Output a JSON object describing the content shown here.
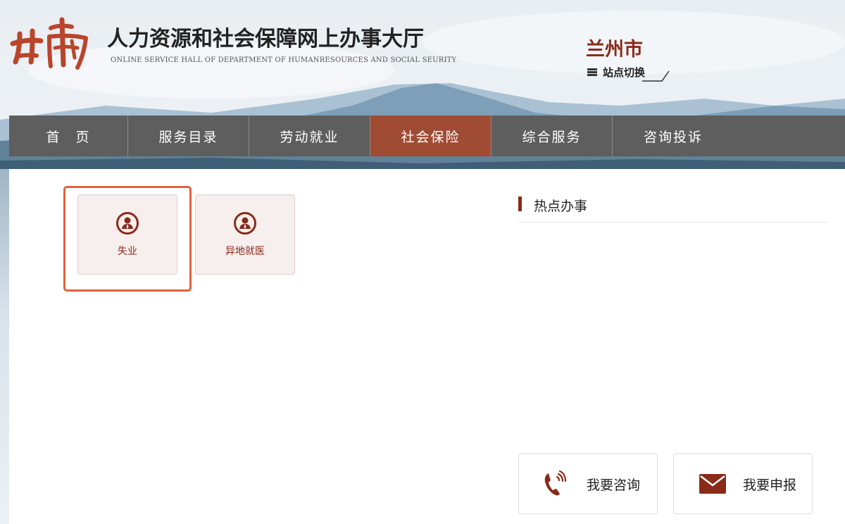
{
  "header": {
    "logo_text": "甘肃",
    "title": "人力资源和社会保障网上办事大厅",
    "subtitle": "ONLINE SERVICE HALL OF DEPARTMENT OF HUMANRESOURCES AND SOCIAL SEURITY",
    "city": "兰州市",
    "switch_label": "站点切换"
  },
  "nav": {
    "items": [
      {
        "label": "首　页",
        "active": false
      },
      {
        "label": "服务目录",
        "active": false
      },
      {
        "label": "劳动就业",
        "active": false
      },
      {
        "label": "社会保险",
        "active": true
      },
      {
        "label": "综合服务",
        "active": false
      },
      {
        "label": "咨询投诉",
        "active": false
      }
    ]
  },
  "services": [
    {
      "label": "失业",
      "icon": "person-icon",
      "selected": true
    },
    {
      "label": "异地就医",
      "icon": "person-icon",
      "selected": false
    }
  ],
  "hot": {
    "title": "热点办事"
  },
  "actions": [
    {
      "label": "我要咨询",
      "icon": "phone-icon"
    },
    {
      "label": "我要申报",
      "icon": "envelope-icon"
    }
  ],
  "colors": {
    "accent": "#8a2b1a",
    "nav_bg": "#5e5e5e",
    "nav_active": "#a04c35",
    "highlight_border": "#e0623a",
    "card_bg": "#f7eeee"
  }
}
